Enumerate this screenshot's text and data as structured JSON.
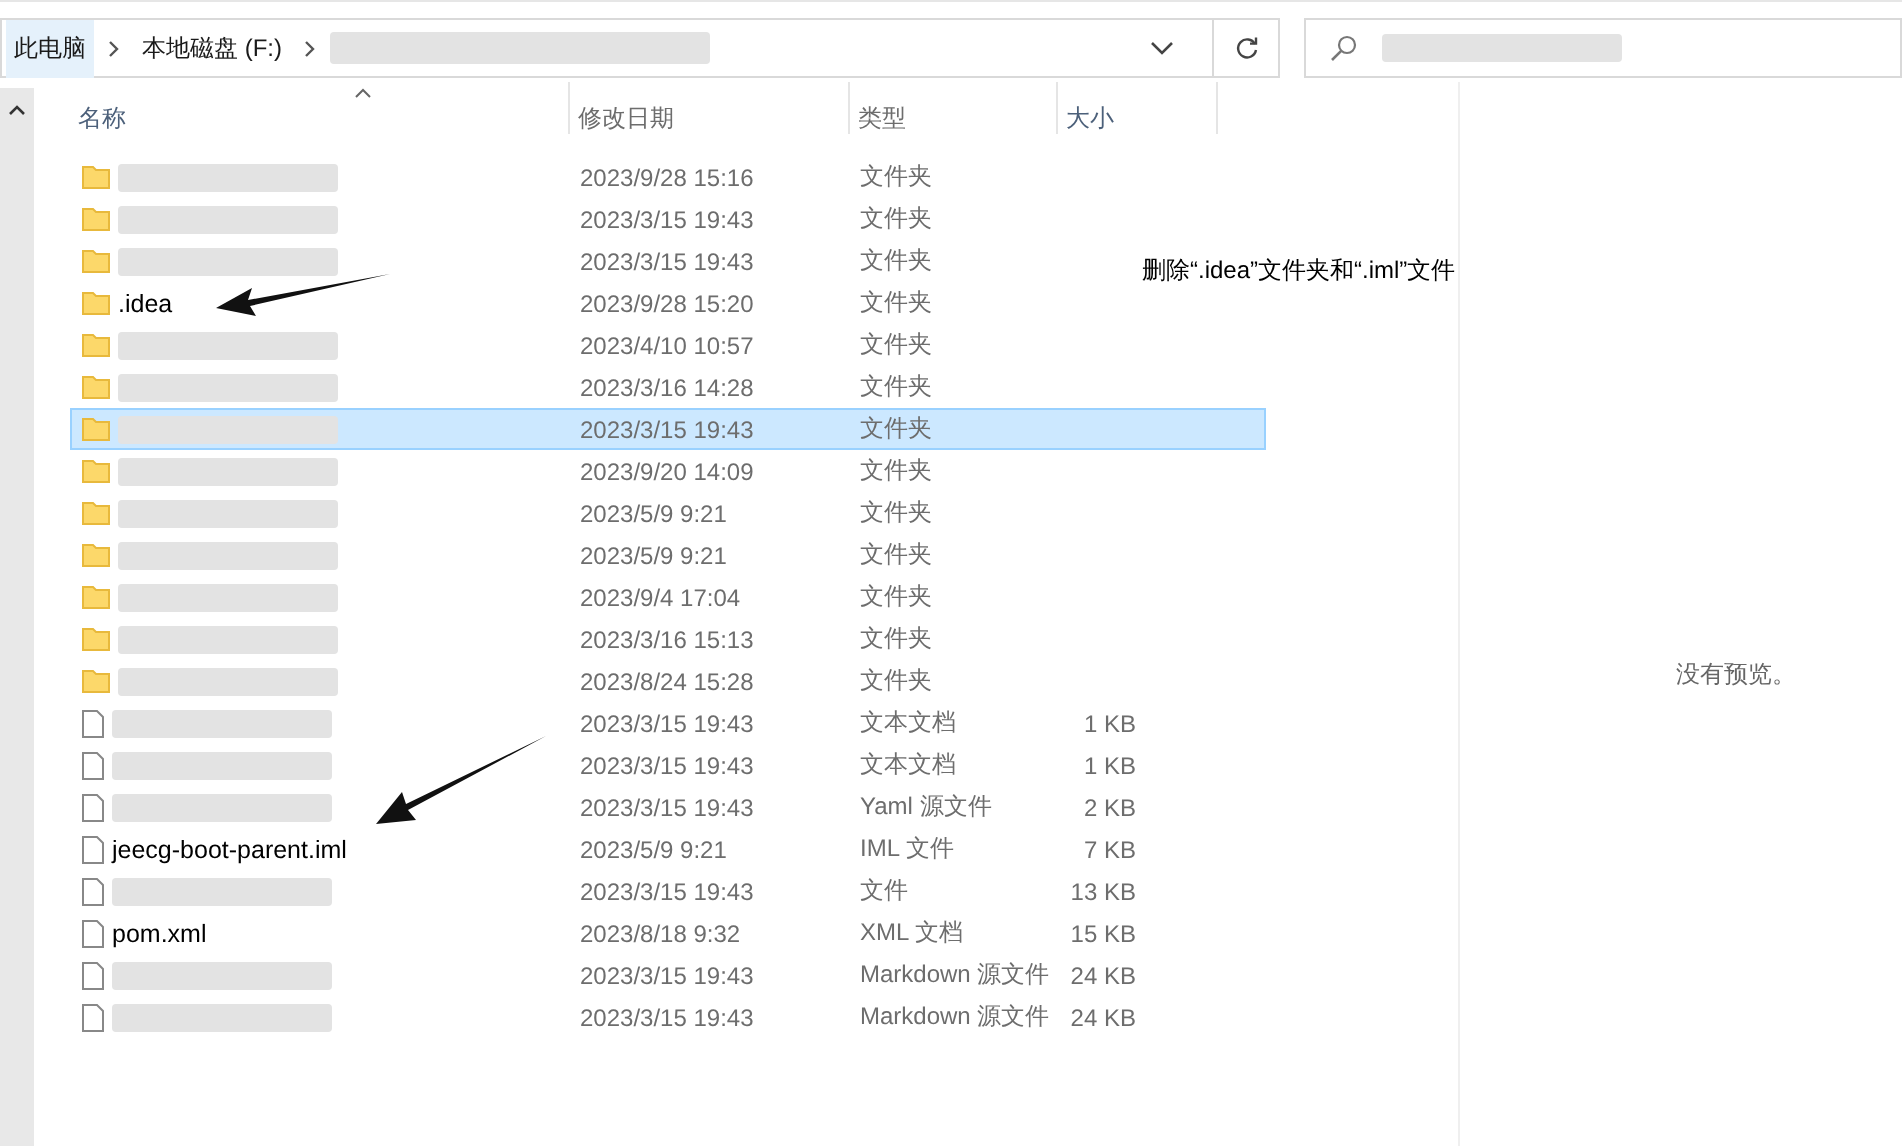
{
  "address_bar": {
    "crumbs": [
      {
        "label": "此电脑",
        "selected": true
      },
      {
        "label": "本地磁盘 (F:)",
        "selected": false
      }
    ]
  },
  "columns": [
    "名称",
    "修改日期",
    "类型",
    "大小"
  ],
  "rows": [
    {
      "kind": "folder",
      "date": "2023/9/28 15:16",
      "type": "文件夹",
      "selected": false
    },
    {
      "kind": "folder",
      "date": "2023/3/15 19:43",
      "type": "文件夹",
      "selected": false
    },
    {
      "kind": "folder",
      "date": "2023/3/15 19:43",
      "type": "文件夹",
      "selected": false
    },
    {
      "kind": "folder",
      "name": ".idea",
      "date": "2023/9/28 15:20",
      "type": "文件夹",
      "selected": false
    },
    {
      "kind": "folder",
      "date": "2023/4/10 10:57",
      "type": "文件夹",
      "selected": false
    },
    {
      "kind": "folder",
      "date": "2023/3/16 14:28",
      "type": "文件夹",
      "selected": false
    },
    {
      "kind": "folder",
      "date": "2023/3/15 19:43",
      "type": "文件夹",
      "selected": true
    },
    {
      "kind": "folder",
      "date": "2023/9/20 14:09",
      "type": "文件夹",
      "selected": false
    },
    {
      "kind": "folder",
      "date": "2023/5/9 9:21",
      "type": "文件夹",
      "selected": false
    },
    {
      "kind": "folder",
      "date": "2023/5/9 9:21",
      "type": "文件夹",
      "selected": false
    },
    {
      "kind": "folder",
      "date": "2023/9/4 17:04",
      "type": "文件夹",
      "selected": false
    },
    {
      "kind": "folder",
      "date": "2023/3/16 15:13",
      "type": "文件夹",
      "selected": false
    },
    {
      "kind": "folder",
      "date": "2023/8/24 15:28",
      "type": "文件夹",
      "selected": false
    },
    {
      "kind": "file",
      "date": "2023/3/15 19:43",
      "type": "文本文档",
      "size": "1 KB",
      "selected": false
    },
    {
      "kind": "file",
      "date": "2023/3/15 19:43",
      "type": "文本文档",
      "size": "1 KB",
      "selected": false
    },
    {
      "kind": "file",
      "date": "2023/3/15 19:43",
      "type": "Yaml 源文件",
      "size": "2 KB",
      "selected": false
    },
    {
      "kind": "file",
      "name": "jeecg-boot-parent.iml",
      "date": "2023/5/9 9:21",
      "type": "IML 文件",
      "size": "7 KB",
      "selected": false
    },
    {
      "kind": "file",
      "date": "2023/3/15 19:43",
      "type": "文件",
      "size": "13 KB",
      "selected": false
    },
    {
      "kind": "file",
      "name": "pom.xml",
      "date": "2023/8/18 9:32",
      "type": "XML 文档",
      "size": "15 KB",
      "selected": false
    },
    {
      "kind": "file",
      "date": "2023/3/15 19:43",
      "type": "Markdown 源文件",
      "size": "24 KB",
      "selected": false
    },
    {
      "kind": "file",
      "date": "2023/3/15 19:43",
      "type": "Markdown 源文件",
      "size": "24 KB",
      "selected": false
    }
  ],
  "annotation": "删除“.idea”文件夹和“.iml”文件",
  "preview": {
    "message": "没有预览。"
  }
}
